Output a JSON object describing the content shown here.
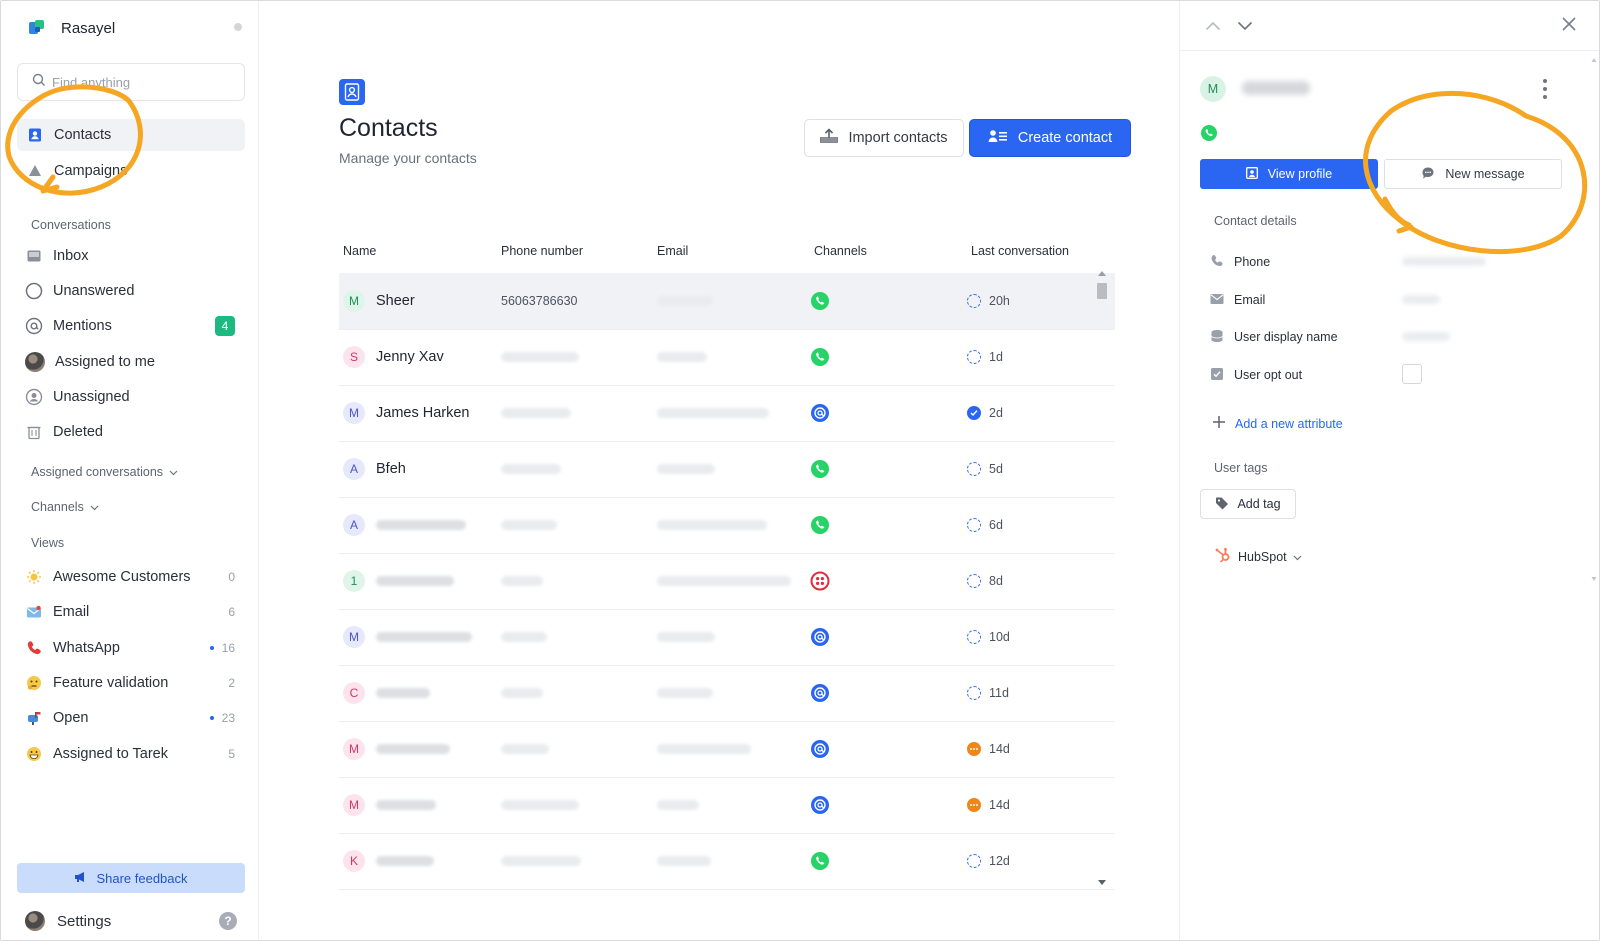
{
  "colors": {
    "accent": "#2a66f2",
    "whatsapp": "#25d366",
    "badge_green": "#1eb980",
    "annotation_orange": "#f5a623",
    "selected_row": "#f1f2f5"
  },
  "sidebar": {
    "brand": "Rasayel",
    "search_placeholder": "Find anything",
    "nav": [
      {
        "label": "Contacts",
        "icon": "contacts-icon",
        "active": true
      },
      {
        "label": "Campaigns",
        "icon": "campaign-icon",
        "active": false
      }
    ],
    "conversations_label": "Conversations",
    "conversations": [
      {
        "label": "Inbox",
        "icon": "inbox-icon"
      },
      {
        "label": "Unanswered",
        "icon": "circle-icon"
      },
      {
        "label": "Mentions",
        "icon": "at-icon",
        "badge": "4"
      },
      {
        "label": "Assigned to me",
        "icon": "avatar"
      },
      {
        "label": "Unassigned",
        "icon": "user-circle-icon"
      },
      {
        "label": "Deleted",
        "icon": "trash-icon"
      }
    ],
    "assigned_conversations_label": "Assigned conversations",
    "channels_label": "Channels",
    "views_label": "Views",
    "views": [
      {
        "label": "Awesome Customers",
        "icon": "sparkle-emoji-icon",
        "count": "0",
        "dot": false
      },
      {
        "label": "Email",
        "icon": "email-emoji-icon",
        "count": "6",
        "dot": false
      },
      {
        "label": "WhatsApp",
        "icon": "phone-emoji-icon",
        "count": "16",
        "dot": true
      },
      {
        "label": "Feature validation",
        "icon": "thinking-emoji-icon",
        "count": "2",
        "dot": false
      },
      {
        "label": "Open",
        "icon": "mailbox-emoji-icon",
        "count": "23",
        "dot": true
      },
      {
        "label": "Assigned to Tarek",
        "icon": "grin-emoji-icon",
        "count": "5",
        "dot": false
      }
    ],
    "share_feedback": "Share feedback",
    "settings": "Settings",
    "help": "?"
  },
  "main": {
    "title": "Contacts",
    "subtitle": "Manage your contacts",
    "import_label": "Import contacts",
    "create_label": "Create contact",
    "columns": [
      "Name",
      "Phone number",
      "Email",
      "Channels",
      "Last conversation"
    ],
    "rows": [
      {
        "initial": "M",
        "name": "Sheer",
        "name_blurred": false,
        "phone": "56063786630",
        "phone_blurred": false,
        "channel": "whatsapp",
        "status": "open",
        "last": "20h",
        "selected": true
      },
      {
        "initial": "S",
        "name": "Jenny Xav",
        "name_blurred": false,
        "phone": "",
        "phone_blurred": true,
        "channel": "whatsapp",
        "status": "open",
        "last": "1d",
        "selected": false
      },
      {
        "initial": "M",
        "name": "James Harken",
        "name_blurred": false,
        "phone": "",
        "phone_blurred": true,
        "channel": "email",
        "status": "done",
        "last": "2d",
        "selected": false
      },
      {
        "initial": "A",
        "name": "Bfeh",
        "name_blurred": false,
        "phone": "",
        "phone_blurred": true,
        "channel": "whatsapp",
        "status": "open",
        "last": "5d",
        "selected": false
      },
      {
        "initial": "A",
        "name": "",
        "name_blurred": true,
        "phone": "",
        "phone_blurred": true,
        "channel": "whatsapp",
        "status": "open",
        "last": "6d",
        "selected": false
      },
      {
        "initial": "1",
        "name": "",
        "name_blurred": true,
        "phone": "",
        "phone_blurred": true,
        "channel": "twilio",
        "status": "open",
        "last": "8d",
        "selected": false
      },
      {
        "initial": "M",
        "name": "",
        "name_blurred": true,
        "phone": "",
        "phone_blurred": true,
        "channel": "email",
        "status": "open",
        "last": "10d",
        "selected": false
      },
      {
        "initial": "C",
        "name": "",
        "name_blurred": true,
        "phone": "",
        "phone_blurred": true,
        "channel": "email",
        "status": "open",
        "last": "11d",
        "selected": false
      },
      {
        "initial": "M",
        "name": "",
        "name_blurred": true,
        "phone": "",
        "phone_blurred": true,
        "channel": "email",
        "status": "pending",
        "last": "14d",
        "selected": false
      },
      {
        "initial": "M",
        "name": "",
        "name_blurred": true,
        "phone": "",
        "phone_blurred": true,
        "channel": "email",
        "status": "pending",
        "last": "14d",
        "selected": false
      },
      {
        "initial": "K",
        "name": "",
        "name_blurred": true,
        "phone": "",
        "phone_blurred": true,
        "channel": "whatsapp",
        "status": "open",
        "last": "12d",
        "selected": false
      }
    ]
  },
  "panel": {
    "avatar_initial": "M",
    "view_profile": "View profile",
    "new_message": "New message",
    "contact_details_label": "Contact details",
    "attributes": [
      {
        "label": "Phone",
        "icon": "phone-icon"
      },
      {
        "label": "Email",
        "icon": "mail-icon"
      },
      {
        "label": "User display name",
        "icon": "database-icon"
      },
      {
        "label": "User opt out",
        "icon": "checkbox-icon"
      }
    ],
    "add_attribute": "Add a new attribute",
    "user_tags_label": "User tags",
    "add_tag": "Add tag",
    "hubspot": "HubSpot"
  }
}
